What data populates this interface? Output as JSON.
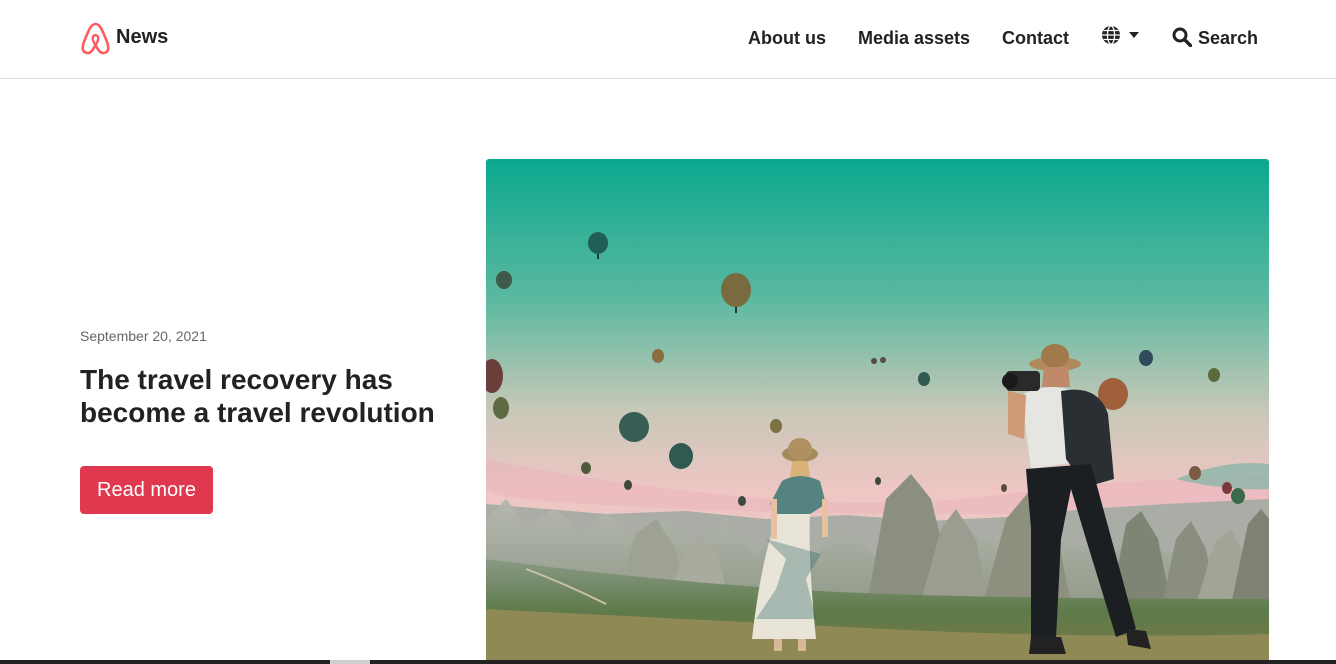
{
  "header": {
    "brand": "News",
    "logo_icon": "airbnb-belo-icon",
    "nav": [
      "About us",
      "Media assets",
      "Contact"
    ],
    "language_icon": "globe-icon",
    "search_label": "Search",
    "search_icon": "search-icon"
  },
  "featured": {
    "date": "September 20, 2021",
    "title": "The travel recovery has become a travel revolution",
    "cta": "Read more",
    "image_subject": "hot-air-balloons-photo"
  },
  "colors": {
    "brand_red": "#e0384e",
    "logo": "#ff5a5f",
    "text": "#222222",
    "muted": "#666666"
  }
}
